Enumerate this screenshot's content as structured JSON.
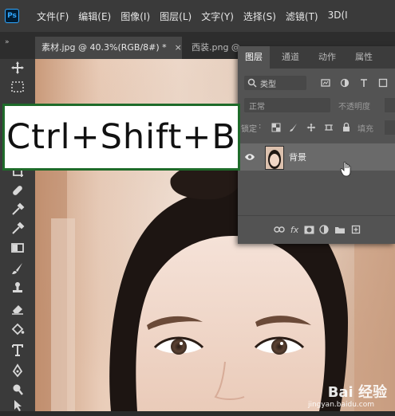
{
  "app": {
    "logo_text": "Ps"
  },
  "menubar": {
    "items": [
      "文件(F)",
      "编辑(E)",
      "图像(I)",
      "图层(L)",
      "文字(Y)",
      "选择(S)",
      "滤镜(T)",
      "3D(I"
    ]
  },
  "tabs": {
    "collapse_glyph": "»",
    "active": {
      "label": "素材.jpg @ 40.3%(RGB/8#) *",
      "close": "×"
    },
    "inactive": {
      "label": "西装.png @"
    }
  },
  "layers_panel": {
    "tabs": [
      "图层",
      "通道",
      "动作",
      "属性"
    ],
    "filter_label": "类型",
    "blend_mode": "正常",
    "opacity_label": "不透明度",
    "lock_label": "锁定",
    "fill_label": "填充",
    "layer_name": "背景",
    "bottom_icons": [
      "link-icon",
      "fx-icon",
      "mask-icon",
      "adjustment-icon",
      "group-icon",
      "new-layer-icon"
    ],
    "fx_label": "fx"
  },
  "overlay": {
    "shortcut": "Ctrl+Shift+B"
  },
  "watermark": {
    "brand": "Bai 经验",
    "url": "jingyan.baidu.com"
  },
  "colors": {
    "ps_blue": "#31a8ff",
    "panel_bg": "#535353",
    "overlay_border": "#1e6b2a"
  }
}
